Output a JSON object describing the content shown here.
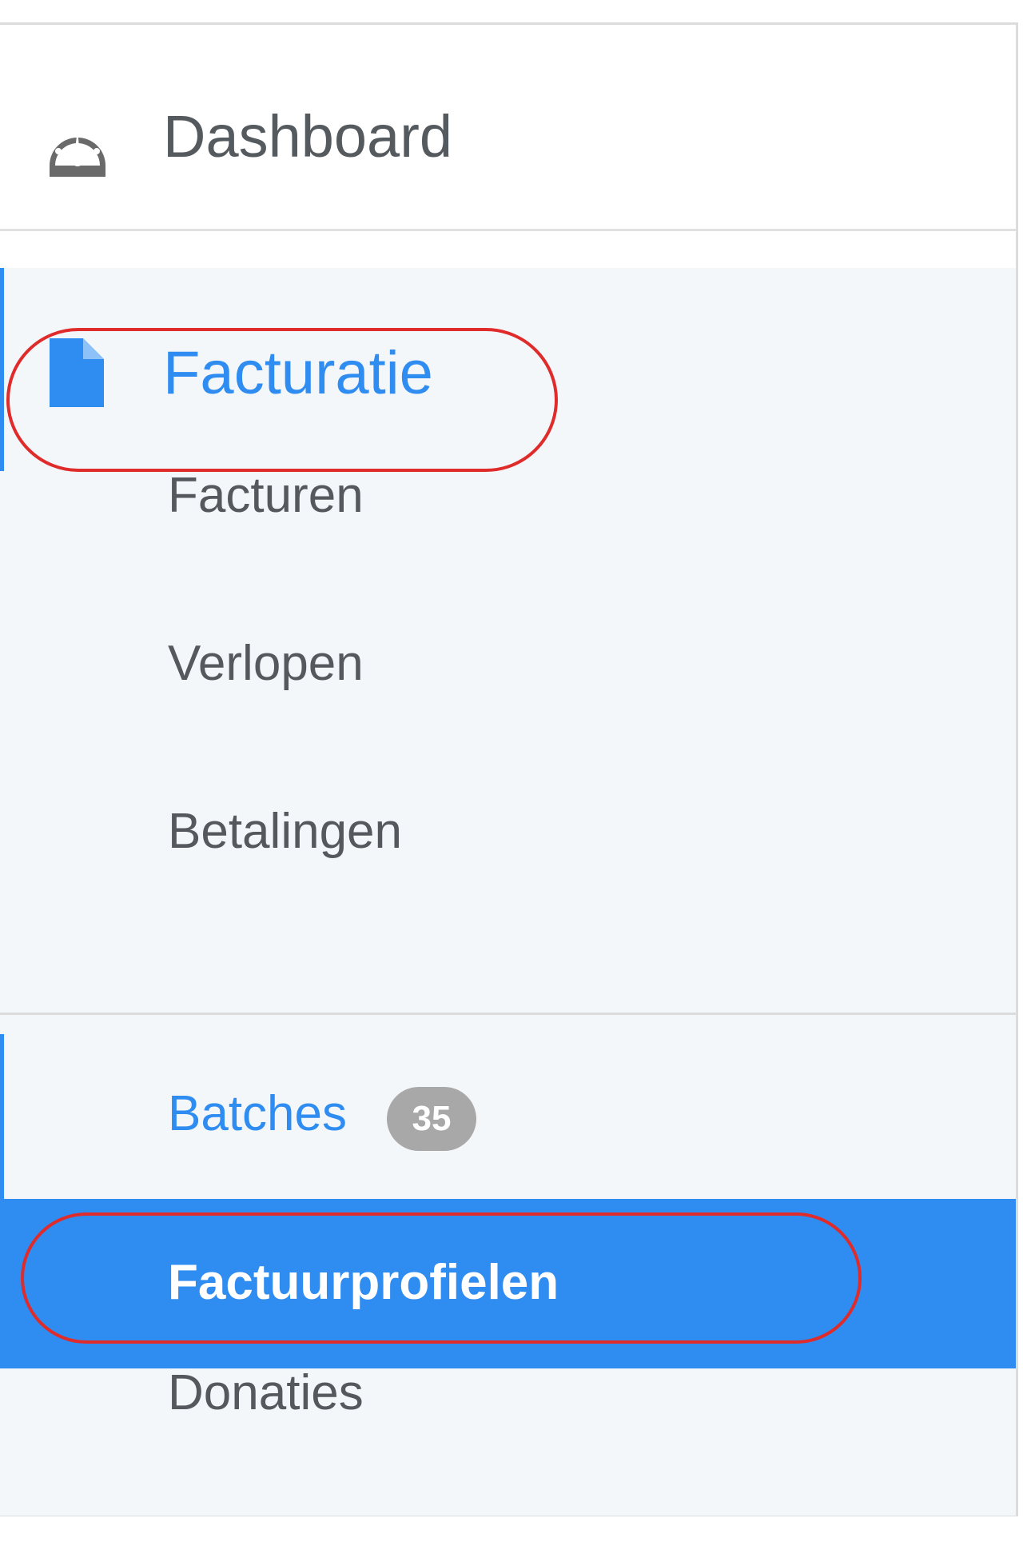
{
  "sidebar": {
    "dashboard": {
      "label": "Dashboard",
      "icon": "dashboard-gauge-icon"
    },
    "section": {
      "label": "Facturatie",
      "icon": "document-icon",
      "accent_color": "#2f8cf0"
    },
    "items": [
      {
        "label": "Facturen"
      },
      {
        "label": "Verlopen"
      },
      {
        "label": "Betalingen"
      },
      {
        "label": "Batches",
        "badge": "35"
      },
      {
        "label": "Factuurprofielen",
        "active": true
      },
      {
        "label": "Donaties"
      }
    ]
  },
  "colors": {
    "accent": "#2f8cf0",
    "annotation": "#e02b2b",
    "text": "#55595e",
    "section_background": "#f4f7fa"
  }
}
